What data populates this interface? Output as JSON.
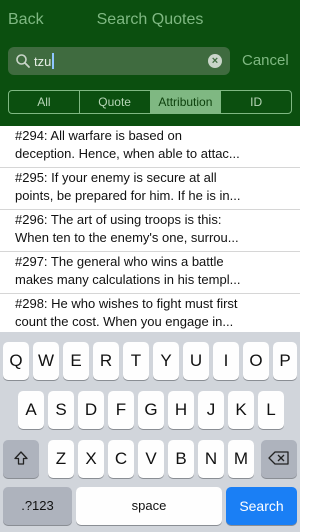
{
  "nav": {
    "back_label": "Back",
    "title": "Search Quotes"
  },
  "search": {
    "query": "tzu",
    "cancel_label": "Cancel"
  },
  "segments": [
    {
      "label": "All",
      "active": false
    },
    {
      "label": "Quote",
      "active": false
    },
    {
      "label": "Attribution",
      "active": true
    },
    {
      "label": "ID",
      "active": false
    }
  ],
  "results": [
    {
      "line1": "#294: All warfare is based on",
      "line2": "deception. Hence, when able to attac..."
    },
    {
      "line1": "#295: If your enemy is secure at all",
      "line2": "points, be prepared for him. If he is in..."
    },
    {
      "line1": "#296: The art of using troops is this:",
      "line2": "When ten to the enemy's one, surrou..."
    },
    {
      "line1": "#297: The general who wins a battle",
      "line2": "makes many calculations in his templ..."
    },
    {
      "line1": "#298: He who wishes to fight must first",
      "line2": "count the cost. When you engage in..."
    }
  ],
  "keyboard": {
    "row1": [
      "Q",
      "W",
      "E",
      "R",
      "T",
      "Y",
      "U",
      "I",
      "O",
      "P"
    ],
    "row2": [
      "A",
      "S",
      "D",
      "F",
      "G",
      "H",
      "J",
      "K",
      "L"
    ],
    "row3": [
      "Z",
      "X",
      "C",
      "V",
      "B",
      "N",
      "M"
    ],
    "numbers_label": ".?123",
    "space_label": "space",
    "search_label": "Search",
    "shift_icon": "shift-icon",
    "delete_icon": "delete-icon"
  },
  "colors": {
    "header_bg": "#0b4f0f",
    "accent": "#7fb882",
    "search_key": "#1a7ff5"
  }
}
